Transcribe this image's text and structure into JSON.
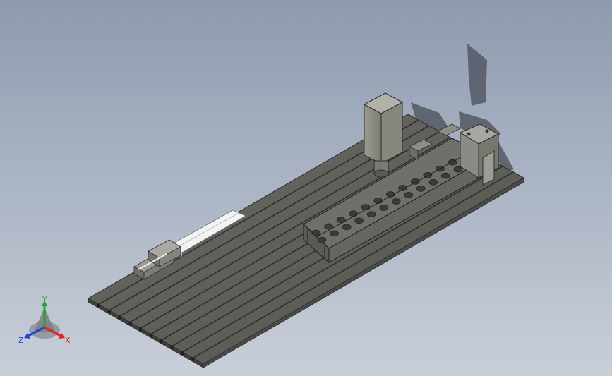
{
  "viewport": {
    "background_top": "#8e9bae",
    "background_bottom": "#c9cfd9"
  },
  "model": {
    "base_plate": {
      "label": "",
      "color": "#5f5f5c",
      "slot_color": "#2e2e2c",
      "slot_count": 10
    },
    "linear_rail": {
      "color": "#f2f2f2"
    },
    "carriage_block": {
      "color": "#8f8f8b"
    },
    "spindle_motor": {
      "color": "#8d8d85"
    },
    "truss_frame": {
      "color": "#6e6e6a"
    },
    "end_mount": {
      "color": "#9a9993"
    }
  },
  "triad": {
    "x_label": "X",
    "y_label": "Y",
    "z_label": "Z",
    "x_color": "#e0201c",
    "y_color": "#23a429",
    "z_color": "#2442d8"
  }
}
